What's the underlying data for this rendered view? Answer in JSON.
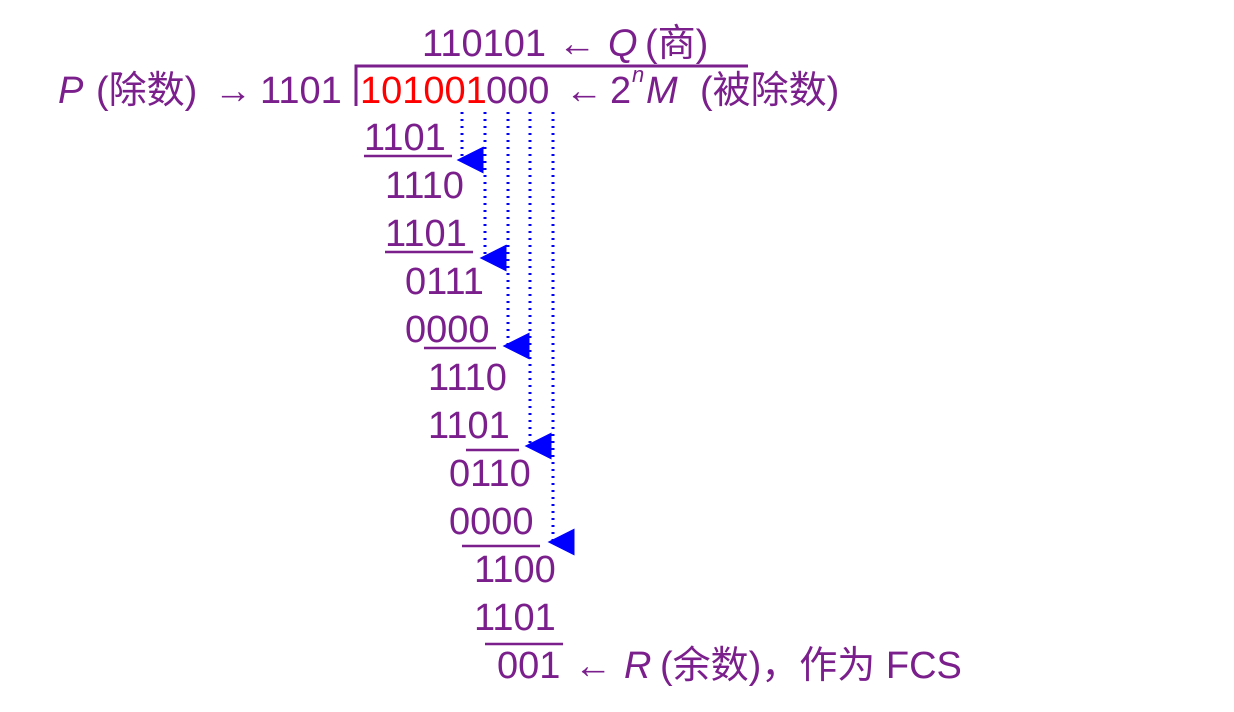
{
  "colors": {
    "text": "#7a1f8c",
    "highlight": "#ff0000",
    "arrow": "#0000ff",
    "background": "#ffffff"
  },
  "quotient": {
    "value": "110101",
    "arrow": "←",
    "symbol": "Q",
    "label": "(商)"
  },
  "divisor": {
    "symbol": "P",
    "label": "(除数)",
    "arrow": "→",
    "value": "1101"
  },
  "dividend": {
    "highlighted": "101001",
    "appended": "000",
    "arrow": "←",
    "coef": "2",
    "exponent": "n",
    "symbol": "M",
    "label": "(被除数)"
  },
  "steps": [
    "1101",
    "1110",
    "1101",
    "0111",
    "0000",
    "1110",
    "1101",
    "0110",
    "0000",
    "1100",
    "1101",
    "001"
  ],
  "remainder": {
    "arrow": "←",
    "symbol": "R",
    "label": "(余数)，作为 FCS"
  }
}
